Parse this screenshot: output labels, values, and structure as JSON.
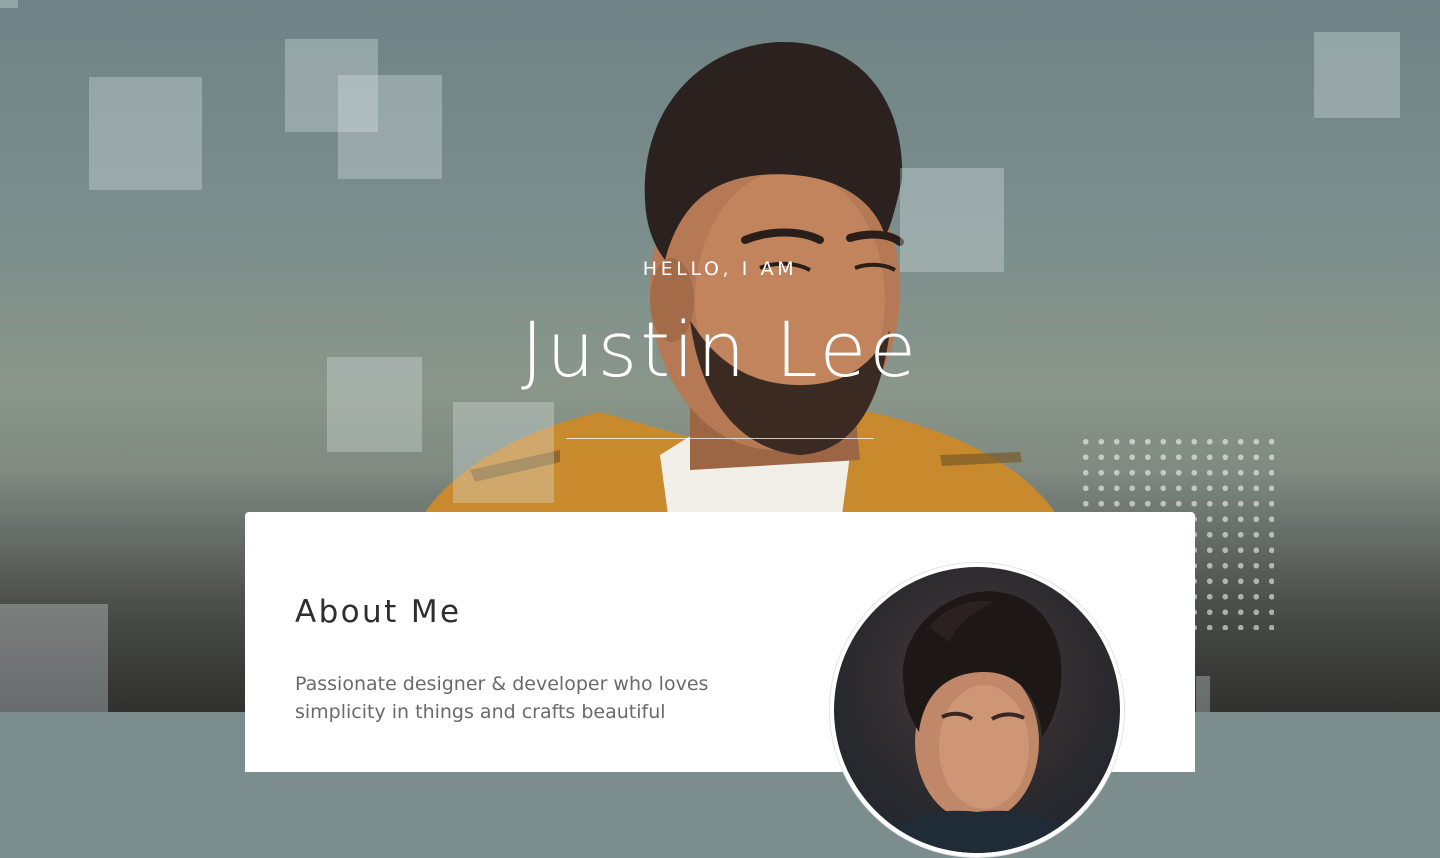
{
  "hero": {
    "greeting": "HELLO, I AM",
    "name": "Justin Lee"
  },
  "about": {
    "title": "About Me",
    "text": "Passionate designer & developer who loves simplicity in things and crafts beautiful"
  },
  "colors": {
    "overlay_squares": "#e1e8eb",
    "card_background": "#ffffff",
    "title_text": "#2e2e2e",
    "body_text": "#6a6a6a",
    "jacket": "#c98a2e"
  }
}
